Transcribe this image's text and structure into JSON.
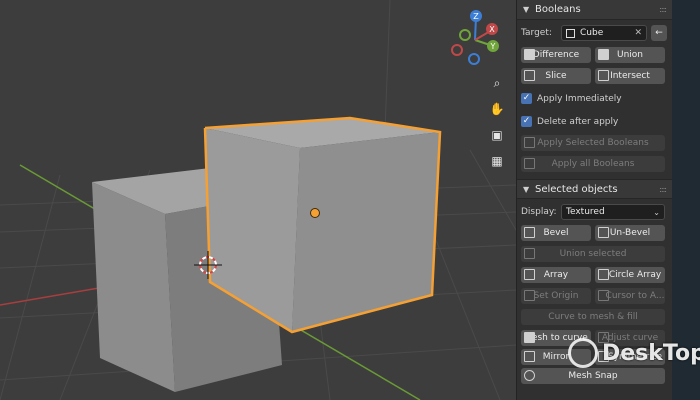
{
  "booleans_panel": {
    "title": "Booleans",
    "target_label": "Target:",
    "target_value": "Cube",
    "buttons": {
      "difference": "Difference",
      "union": "Union",
      "slice": "Slice",
      "intersect": "Intersect"
    },
    "apply_immediately": {
      "label": "Apply Immediately",
      "checked": true
    },
    "delete_after_apply": {
      "label": "Delete after apply",
      "checked": true
    },
    "apply_selected": "Apply Selected Booleans",
    "apply_all": "Apply all Booleans"
  },
  "selected_panel": {
    "title": "Selected objects",
    "display_label": "Display:",
    "display_value": "Textured",
    "bevel": "Bevel",
    "unbevel": "Un-Bevel",
    "union_selected": "Union selected",
    "array": "Array",
    "circle_array": "Circle Array",
    "set_origin": "Set Origin",
    "cursor_to": "Cursor to A...",
    "curve_to_mesh": "Curve to mesh & fill",
    "mesh_to_curve": "Mesh to curve",
    "adjust_curve": "Adjust curve",
    "mirror": "Mirror",
    "symmetrize": "Symmetrize",
    "mesh_snap": "Mesh Snap"
  },
  "gizmo": {
    "x": "X",
    "y": "Y",
    "z": "Z"
  },
  "watermark": "DeskTop",
  "colors": {
    "selection_outline": "#f5a033",
    "axis_x": "#c14848",
    "axis_y": "#6fa53a",
    "axis_z": "#3d7fd6",
    "checkbox": "#4772b3"
  }
}
